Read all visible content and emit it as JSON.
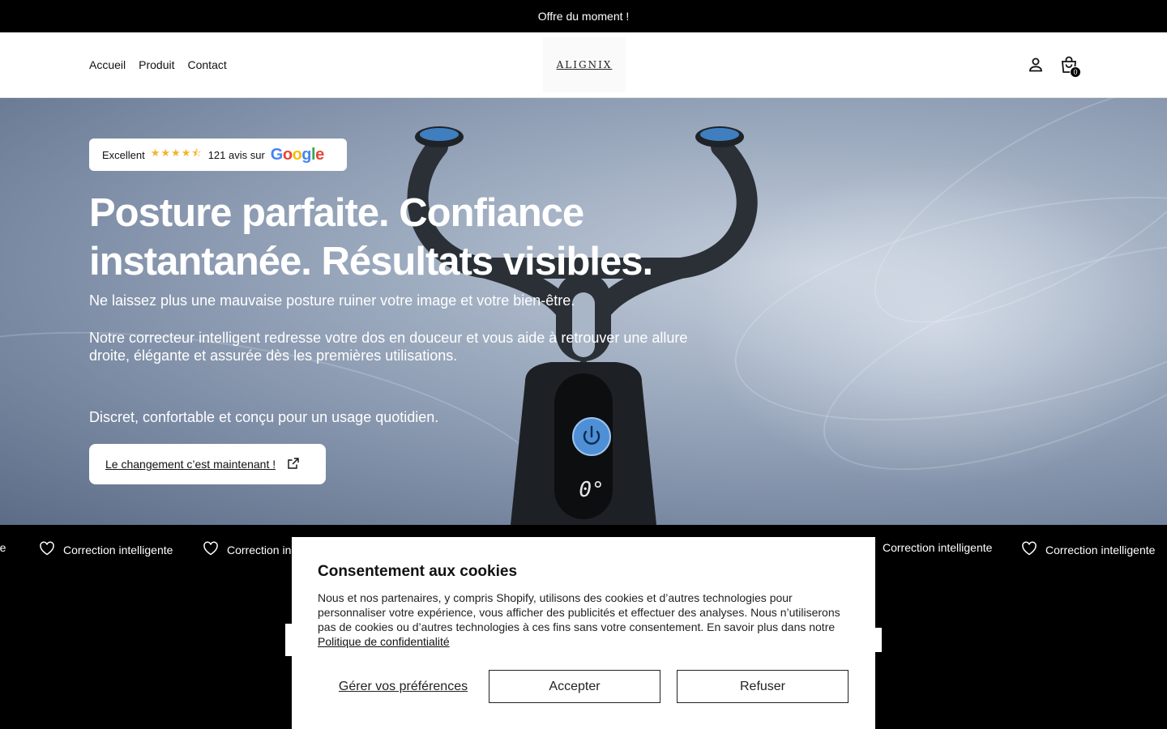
{
  "announcement": "Offre du moment !",
  "header": {
    "nav": [
      "Accueil",
      "Produit",
      "Contact"
    ],
    "logo": "ALIGNIX",
    "cart_count": "0"
  },
  "hero": {
    "rating_label": "Excellent",
    "review_count_text": "121 avis sur",
    "review_source": "Google",
    "headline": "Posture parfaite. Confiance instantanée. Résultats visibles.",
    "subtitle": "Ne laissez plus une mauvaise posture ruiner votre image et votre bien-être.",
    "description": "Notre correcteur intelligent redresse votre dos en douceur et vous aide à retrouver une allure droite, élégante et assurée dès les premières utilisations.",
    "tagline": "Discret, confortable et conçu pour un usage quotidien.",
    "cta_label": "Le changement c’est maintenant !",
    "device_display": "0°",
    "star_rating": 4.5
  },
  "marquee": {
    "items": [
      "nte",
      "Correction intelligente",
      "Correction in",
      "Correction intelligente",
      "Correction intelligente"
    ]
  },
  "cookie": {
    "title": "Consentement aux cookies",
    "body": "Nous et nos partenaires, y compris Shopify, utilisons des cookies et d’autres technologies pour personnaliser votre expérience, vous afficher des publicités et effectuer des analyses. Nous n’utiliserons pas de cookies ou d’autres technologies à ces fins sans votre consentement. En savoir plus dans notre",
    "privacy_link": "Politique de confidentialité",
    "manage_label": "Gérer vos préférences",
    "accept_label": "Accepter",
    "decline_label": "Refuser"
  }
}
